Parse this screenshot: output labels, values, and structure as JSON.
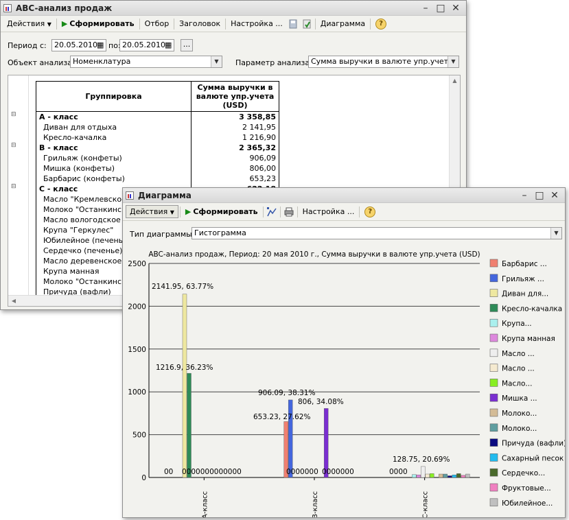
{
  "back_window": {
    "title": "ABC-анализ продаж",
    "toolbar": {
      "actions_label": "Действия",
      "generate_label": "Сформировать",
      "filter_label": "Отбор",
      "header_label": "Заголовок",
      "settings_label": "Настройка ...",
      "diagram_label": "Диаграмма"
    },
    "period": {
      "from_label": "Период с:",
      "from_value": "20.05.2010",
      "to_label": "по:",
      "to_value": "20.05.2010",
      "more_label": "..."
    },
    "analysis_object": {
      "label": "Объект анализа:",
      "value": "Номенклатура"
    },
    "analysis_param": {
      "label": "Параметр анализа:",
      "value": "Сумма выручки в валюте упр.учета (US"
    },
    "table": {
      "col_group": "Группировка",
      "col_sum": "Сумма выручки в валюте упр.учета (USD)",
      "rows": [
        {
          "name": "A - класс",
          "value": "3 358,85",
          "kind": "class"
        },
        {
          "name": "Диван для отдыха",
          "value": "2 141,95",
          "kind": "item"
        },
        {
          "name": "Кресло-качалка",
          "value": "1 216,90",
          "kind": "item"
        },
        {
          "name": "B - класс",
          "value": "2 365,32",
          "kind": "class"
        },
        {
          "name": "Грильяж (конфеты)",
          "value": "906,09",
          "kind": "item"
        },
        {
          "name": "Мишка (конфеты)",
          "value": "806,00",
          "kind": "item"
        },
        {
          "name": "Барбарис (конфеты)",
          "value": "653,23",
          "kind": "item"
        },
        {
          "name": "C - класс",
          "value": "622,18",
          "kind": "class"
        },
        {
          "name": "Масло \"Кремлевское\"",
          "value": "",
          "kind": "item"
        },
        {
          "name": "Молоко \"Останкинское",
          "value": "",
          "kind": "item"
        },
        {
          "name": "Масло вологодское",
          "value": "",
          "kind": "item"
        },
        {
          "name": "Крупа \"Геркулес\"",
          "value": "",
          "kind": "item"
        },
        {
          "name": "Юбилейное (печенье)",
          "value": "",
          "kind": "item"
        },
        {
          "name": "Сердечко (печенье)",
          "value": "",
          "kind": "item"
        },
        {
          "name": "Масло деревенское",
          "value": "",
          "kind": "item"
        },
        {
          "name": "Крупа манная",
          "value": "",
          "kind": "item"
        },
        {
          "name": "Молоко \"Останкинское",
          "value": "",
          "kind": "item"
        },
        {
          "name": "Причуда (вафли)",
          "value": "",
          "kind": "item"
        }
      ]
    }
  },
  "front_window": {
    "title": "Диаграмма",
    "toolbar": {
      "actions_label": "Действия",
      "generate_label": "Сформировать",
      "settings_label": "Настройка ..."
    },
    "chart_type": {
      "label": "Тип диаграммы:",
      "value": "Гистограмма"
    }
  },
  "colors": {
    "arrow": "#f0a33c",
    "barbaris": "#f08070",
    "grilyazh": "#4466dd",
    "divan": "#eee8a0",
    "kreslo": "#2e8b57",
    "mishka": "#7a2ed0"
  },
  "chart_data": {
    "type": "bar",
    "title": "ABC-анализ продаж, Период: 20 мая 2010 г., Сумма выручки в  валюте упр.учета (USD)",
    "categories": [
      "А-класс",
      "В-класс",
      "С-класс"
    ],
    "ylim": [
      0,
      2500
    ],
    "yticks": [
      0,
      500,
      1000,
      1500,
      2000,
      2500
    ],
    "grid": true,
    "legend_position": "right",
    "series": [
      {
        "name": "Барбарис ...",
        "color": "#f08070",
        "values": [
          0,
          653.23,
          0
        ]
      },
      {
        "name": "Грильяж ...",
        "color": "#4466dd",
        "values": [
          0,
          906.09,
          0
        ]
      },
      {
        "name": "Диван для...",
        "color": "#eee8a0",
        "values": [
          2141.95,
          0,
          0
        ]
      },
      {
        "name": "Кресло-качалка",
        "color": "#2e8b57",
        "values": [
          1216.9,
          0,
          0
        ]
      },
      {
        "name": "Крупа...",
        "color": "#aaf0ee",
        "values": [
          0,
          0,
          34
        ]
      },
      {
        "name": "Крупа манная",
        "color": "#dd88dd",
        "values": [
          0,
          0,
          30
        ]
      },
      {
        "name": "Масло ...",
        "color": "#eeeeee",
        "values": [
          0,
          0,
          128.75
        ]
      },
      {
        "name": "Масло ...",
        "color": "#f5ead0",
        "values": [
          0,
          0,
          40
        ]
      },
      {
        "name": "Масло...",
        "color": "#88ee22",
        "values": [
          0,
          0,
          45
        ]
      },
      {
        "name": "Мишка ...",
        "color": "#7a2ed0",
        "values": [
          0,
          806,
          0
        ]
      },
      {
        "name": "Молоко...",
        "color": "#d4bc96",
        "values": [
          0,
          0,
          40
        ]
      },
      {
        "name": "Молоко...",
        "color": "#5f9ea0",
        "values": [
          0,
          0,
          40
        ]
      },
      {
        "name": "Причуда (вафли)",
        "color": "#0a0a80",
        "values": [
          0,
          0,
          20
        ]
      },
      {
        "name": "Сахарный песок",
        "color": "#22bbee",
        "values": [
          0,
          0,
          30
        ]
      },
      {
        "name": "Сердечко...",
        "color": "#4a6a2a",
        "values": [
          0,
          0,
          45
        ]
      },
      {
        "name": "Фруктовые...",
        "color": "#f080c0",
        "values": [
          0,
          0,
          25
        ]
      },
      {
        "name": "Юбилейное...",
        "color": "#c0c0c0",
        "values": [
          0,
          0,
          40
        ]
      }
    ],
    "data_labels": [
      "2141.95, 63.77%",
      "1216.9, 36.23%",
      "906.09, 38.31%",
      "806, 34.08%",
      "653.23, 27.62%",
      "128.75, 20.69%",
      "00",
      "0000000000000",
      "0000000",
      "0000000",
      "0000"
    ]
  }
}
